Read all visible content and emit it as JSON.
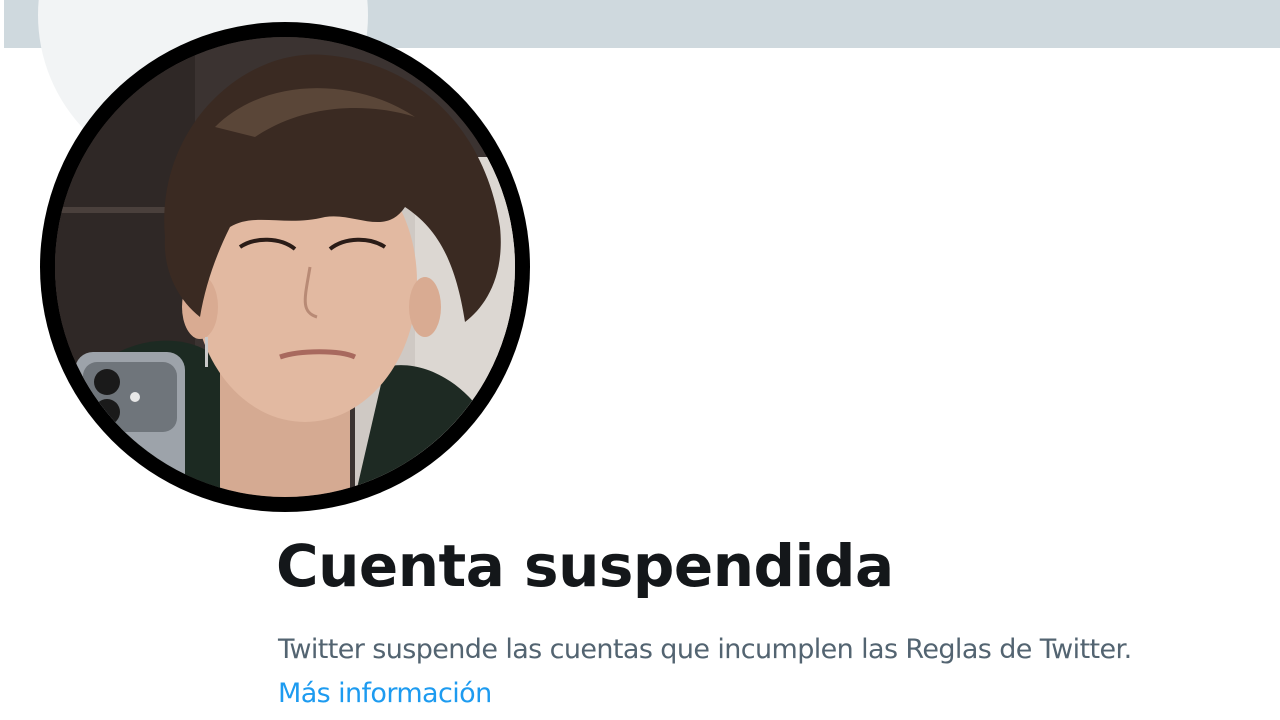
{
  "profile": {
    "banner_color": "#cfd9de",
    "avatar": {
      "icon": "profile-photo",
      "ring_color": "#000000"
    }
  },
  "suspension": {
    "title": "Cuenta suspendida",
    "description": "Twitter suspende las cuentas que incumplen las Reglas de Twitter.",
    "link_label": "Más información"
  },
  "colors": {
    "title": "#14171a",
    "body_text": "#536471",
    "link": "#1d9bf0"
  }
}
